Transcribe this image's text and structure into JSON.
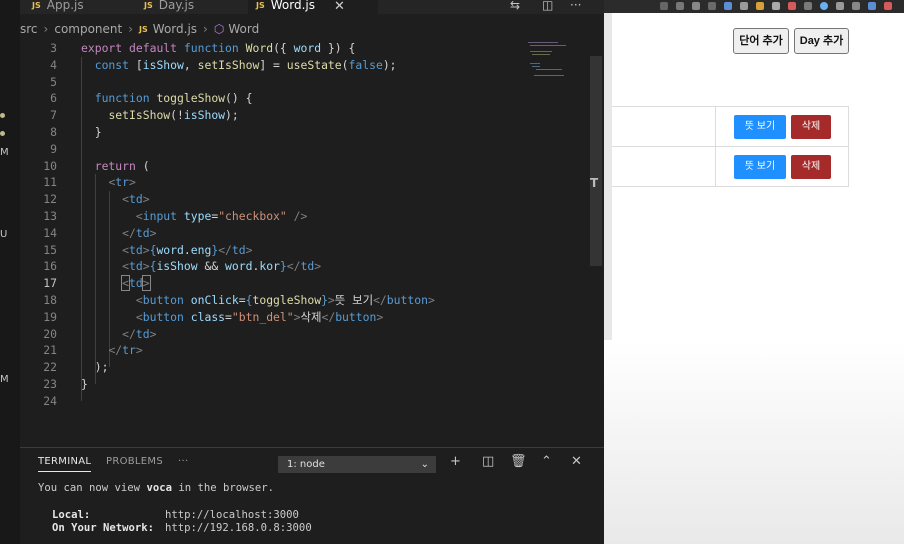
{
  "editor": {
    "tabs": [
      {
        "label": "App.js",
        "type": "JS"
      },
      {
        "label": "Day.js",
        "type": "JS"
      },
      {
        "label": "Word.js",
        "type": "JS",
        "active": true
      }
    ],
    "tab_close": "✕",
    "breadcrumb": [
      "src",
      "component",
      "Word.js",
      "Word"
    ],
    "current_line": 17
  },
  "terminal": {
    "tabs": [
      "TERMINAL",
      "PROBLEMS"
    ],
    "more": "···",
    "select_value": "1: node",
    "lines": [
      {
        "text": "You can now view ",
        "bold": "voca",
        "rest": " in the browser."
      },
      {
        "label": "Local:",
        "value": "http://localhost:3000"
      },
      {
        "label": "On Your Network:",
        "value": "http://192.168.0.8:3000"
      }
    ]
  },
  "browser": {
    "buttons": {
      "add_word": "단어 추가",
      "add_day": "Day 추가"
    },
    "rows": [
      {
        "show_label": "뜻 보기",
        "delete_label": "삭제"
      },
      {
        "show_label": "뜻 보기",
        "delete_label": "삭제"
      }
    ]
  },
  "activity_marks": [
    "M",
    "U",
    "M"
  ]
}
